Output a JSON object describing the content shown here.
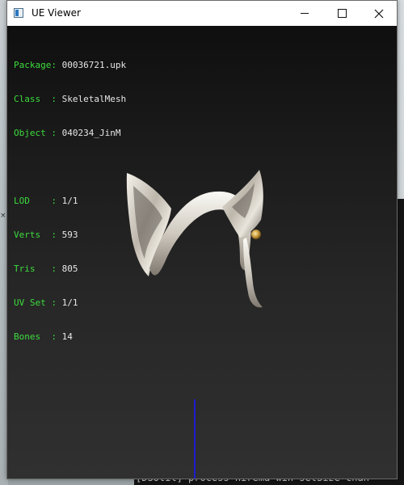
{
  "window": {
    "title": "UE Viewer",
    "buttons": {
      "minimize": "minimize-icon",
      "maximize": "maximize-icon",
      "close": "close-icon"
    }
  },
  "info": {
    "package_label": "Package: ",
    "package_value": "00036721.upk",
    "class_label": "Class  : ",
    "class_value": "SkeletalMesh",
    "object_label": "Object : ",
    "object_value": "040234_JinM",
    "lod_label": "LOD    : ",
    "lod_value": "1/1",
    "verts_label": "Verts  : ",
    "verts_value": "593",
    "tris_label": "Tris   : ",
    "tris_value": "805",
    "uvset_label": "UV Set : ",
    "uvset_value": "1/1",
    "bones_label": "Bones  : ",
    "bones_value": "14"
  },
  "console": {
    "last_line": "[DSUtil] process  hirema win setSize  chan"
  },
  "colors": {
    "label_green": "#3ddc3d",
    "value_white": "#e6e6e6",
    "axis_blue": "#1c1cd0"
  }
}
